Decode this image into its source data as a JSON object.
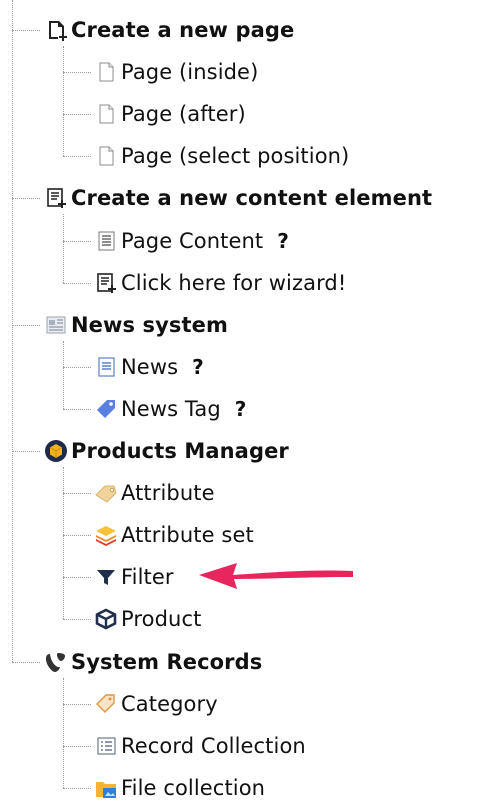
{
  "tree": {
    "sections": [
      {
        "label": "Create a new page",
        "icon": "page-new-icon",
        "children": [
          {
            "label": "Page (inside)",
            "icon": "page-icon"
          },
          {
            "label": "Page (after)",
            "icon": "page-icon"
          },
          {
            "label": "Page (select position)",
            "icon": "page-icon"
          }
        ]
      },
      {
        "label": "Create a new content element",
        "icon": "content-wizard-icon",
        "children": [
          {
            "label": "Page Content",
            "icon": "content-text-icon",
            "help": "?"
          },
          {
            "label": "Click here for wizard!",
            "icon": "content-wizard-icon"
          }
        ]
      },
      {
        "label": "News system",
        "icon": "news-system-icon",
        "children": [
          {
            "label": "News",
            "icon": "news-icon",
            "help": "?"
          },
          {
            "label": "News Tag",
            "icon": "tag-icon",
            "help": "?"
          }
        ]
      },
      {
        "label": "Products Manager",
        "icon": "products-manager-icon",
        "children": [
          {
            "label": "Attribute",
            "icon": "attribute-icon"
          },
          {
            "label": "Attribute set",
            "icon": "attribute-set-icon"
          },
          {
            "label": "Filter",
            "icon": "filter-icon"
          },
          {
            "label": "Product",
            "icon": "product-icon"
          }
        ]
      },
      {
        "label": "System Records",
        "icon": "typo3-icon",
        "children": [
          {
            "label": "Category",
            "icon": "category-icon"
          },
          {
            "label": "Record Collection",
            "icon": "record-collection-icon"
          },
          {
            "label": "File collection",
            "icon": "file-collection-icon"
          }
        ]
      }
    ]
  },
  "annotation": {
    "icon": "pointer-arrow-icon",
    "color": "#e8265e",
    "target": "Filter"
  }
}
